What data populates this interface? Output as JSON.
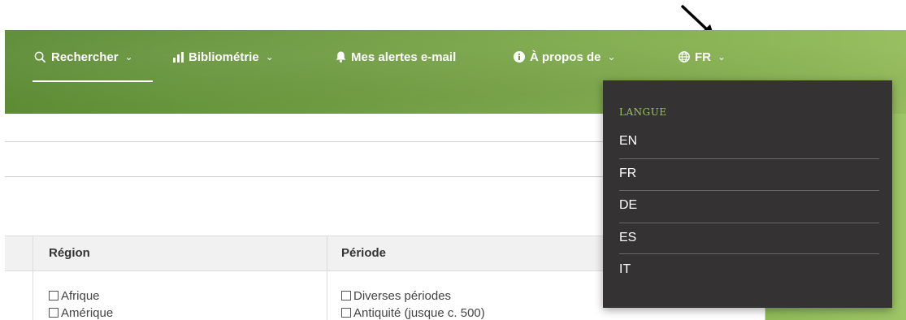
{
  "nav": {
    "search": "Rechercher",
    "bibliometrics": "Bibliométrie",
    "alerts": "Mes alertes e-mail",
    "about": "À propos de",
    "language": "FR"
  },
  "table": {
    "headers": [
      "Région",
      "Période"
    ],
    "region_options": [
      "Afrique",
      "Amérique"
    ],
    "period_options": [
      "Diverses périodes",
      "Antiquité (jusque c. 500)"
    ]
  },
  "language_menu": {
    "title": "LANGUE",
    "items": [
      "EN",
      "FR",
      "DE",
      "ES",
      "IT"
    ]
  },
  "colors": {
    "nav_green": "#6f9c42",
    "dropdown_bg": "#353233",
    "dropdown_title": "#9ac35e"
  }
}
